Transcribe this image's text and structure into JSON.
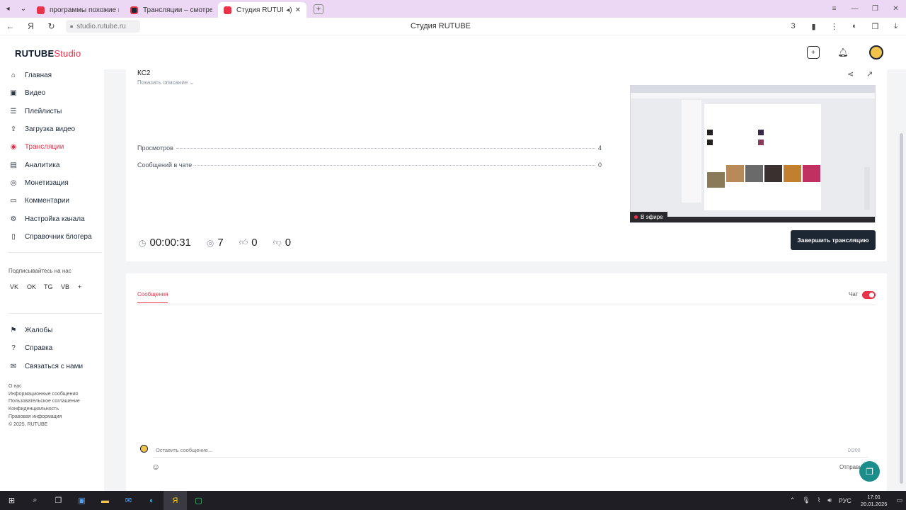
{
  "browser": {
    "tabs": [
      {
        "label": "программы похожие на о",
        "color": "#e6334a"
      },
      {
        "label": "Трансляции – смотреть б",
        "color": "#e6334a"
      },
      {
        "label": "Студия RUTUBE",
        "color": "#e6334a"
      }
    ],
    "url": "studio.rutube.ru",
    "page_title": "Студия RUTUBE",
    "badge_count": "3"
  },
  "header": {
    "logo_main": "RUTUBE",
    "logo_sub": "Studio"
  },
  "sidebar": {
    "items": [
      {
        "label": "Главная",
        "icon": "home-icon",
        "glyph": "⌂"
      },
      {
        "label": "Видео",
        "icon": "video-icon",
        "glyph": "▣"
      },
      {
        "label": "Плейлисты",
        "icon": "playlist-icon",
        "glyph": "☰"
      },
      {
        "label": "Загрузка видео",
        "icon": "upload-icon",
        "glyph": "⇪"
      },
      {
        "label": "Трансляции",
        "icon": "broadcast-icon",
        "glyph": "◉"
      },
      {
        "label": "Аналитика",
        "icon": "analytics-icon",
        "glyph": "▤"
      },
      {
        "label": "Монетизация",
        "icon": "money-icon",
        "glyph": "◎"
      },
      {
        "label": "Комментарии",
        "icon": "comment-icon",
        "glyph": "▭"
      },
      {
        "label": "Настройка канала",
        "icon": "gear-icon",
        "glyph": "⚙"
      },
      {
        "label": "Справочник блогера",
        "icon": "book-icon",
        "glyph": "▯"
      }
    ],
    "follow_label": "Подписывайтесь на нас",
    "socials": [
      "VK",
      "OK",
      "TG",
      "VB",
      "+"
    ],
    "help_items": [
      {
        "label": "Жалобы",
        "icon": "flag-icon",
        "glyph": "⚑"
      },
      {
        "label": "Справка",
        "icon": "help-icon",
        "glyph": "?"
      },
      {
        "label": "Связаться с нами",
        "icon": "mail-icon",
        "glyph": "✉"
      }
    ],
    "footer_links": [
      "О нас",
      "Информационные сообщения",
      "Пользовательское соглашение",
      "Конфиденциальность",
      "Правовая информация",
      "© 2025, RUTUBE"
    ]
  },
  "stream": {
    "title": "КС2",
    "show_description": "Показать описание",
    "views_label": "Просмотров",
    "views_value": "4",
    "chat_messages_label": "Сообщений в чате",
    "chat_messages_value": "0",
    "live_badge": "В эфире",
    "duration": "00:00:31",
    "viewers": "7",
    "likes": "0",
    "dislikes": "0",
    "end_button": "Завершить трансляцию"
  },
  "chat": {
    "tab_label": "Сообщения",
    "toggle_label": "Чат",
    "input_placeholder": "Оставить сообщение...",
    "counter": "0/200",
    "send_label": "Отправить"
  },
  "taskbar": {
    "lang": "РУС",
    "time": "17:01",
    "date": "20.01.2025"
  }
}
